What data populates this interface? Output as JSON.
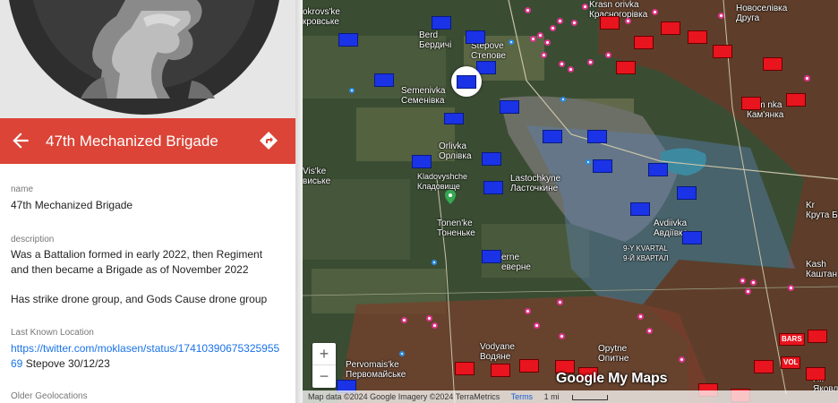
{
  "panel": {
    "title": "47th Mechanized Brigade",
    "fields": {
      "name_label": "name",
      "name_value": "47th Mechanized Brigade",
      "description_label": "description",
      "description_text": "Was a Battalion formed in early 2022, then Regiment and then became a Brigade as of November 2022",
      "description_text_2": "Has strike drone group, and Gods Cause drone group",
      "location_label": "Last Known Location",
      "location_link": "https://twitter.com/moklasen/status/1741039067532595569",
      "location_suffix": " Stepove 30/12/23",
      "older_label": "Older Geolocations"
    },
    "icons": {
      "back": "arrow-left-icon",
      "directions": "directions-icon",
      "emblem": "knight-chess-piece-emblem"
    },
    "header_color": "#db4437"
  },
  "map": {
    "places": {
      "berdychi": "Berd\nБердичі",
      "stepove": "Stepove\nСтепове",
      "semenivka": "Semenivka\nСеменівка",
      "orlivka": "Orlivka\nОрлівка",
      "kladovyshche": "Kladovyshche\nКладовище",
      "lastochkyne": "Lastochkyne\nЛасточкине",
      "tonenke": "Tonen'ke\nТоненьке",
      "sieverne": "erne\nеверне",
      "avdiivka": "Avdiivka\nАвдіївка",
      "kvartal": "9-Y KVARTAL\n9-Й КВАРТАЛ",
      "krasnohorivka": "Krasn orivka\nКрасногорівка",
      "novoselivka": "Новоселівка\nДруга",
      "kamianka": "Kam nka\nКам'янка",
      "kruta": "Kr\nКрута Б",
      "kashtanove": "Kash\nКаштан",
      "vodiane": "Vodyane\nВодяне",
      "opytne": "Opytne\nОпитне",
      "pervomaiske": "Pervomais'ke\nПервомайське",
      "yakovlivka": "Як\nЯковл",
      "okrovske": "okrovs'ke\nкровське",
      "west_label": "Vis'ke\nвиське"
    },
    "unit_labels": {
      "bars": "BARS",
      "vol": "VOL"
    },
    "zoom_in": "+",
    "zoom_out": "−",
    "google_logo": "Google My Maps",
    "attribution": "Map data ©2024 Google Imagery ©2024 TerraMetrics",
    "terms": "Terms",
    "scale": "1 mi",
    "colors": {
      "ukraine_unit": "#1a33e6",
      "russia_unit": "#e8141e",
      "pink_marker": "#e0338a",
      "blue_marker": "#2a8ce8",
      "occupied_overlay": "#7a2020",
      "frontline_area": "#5a7fb0"
    }
  }
}
